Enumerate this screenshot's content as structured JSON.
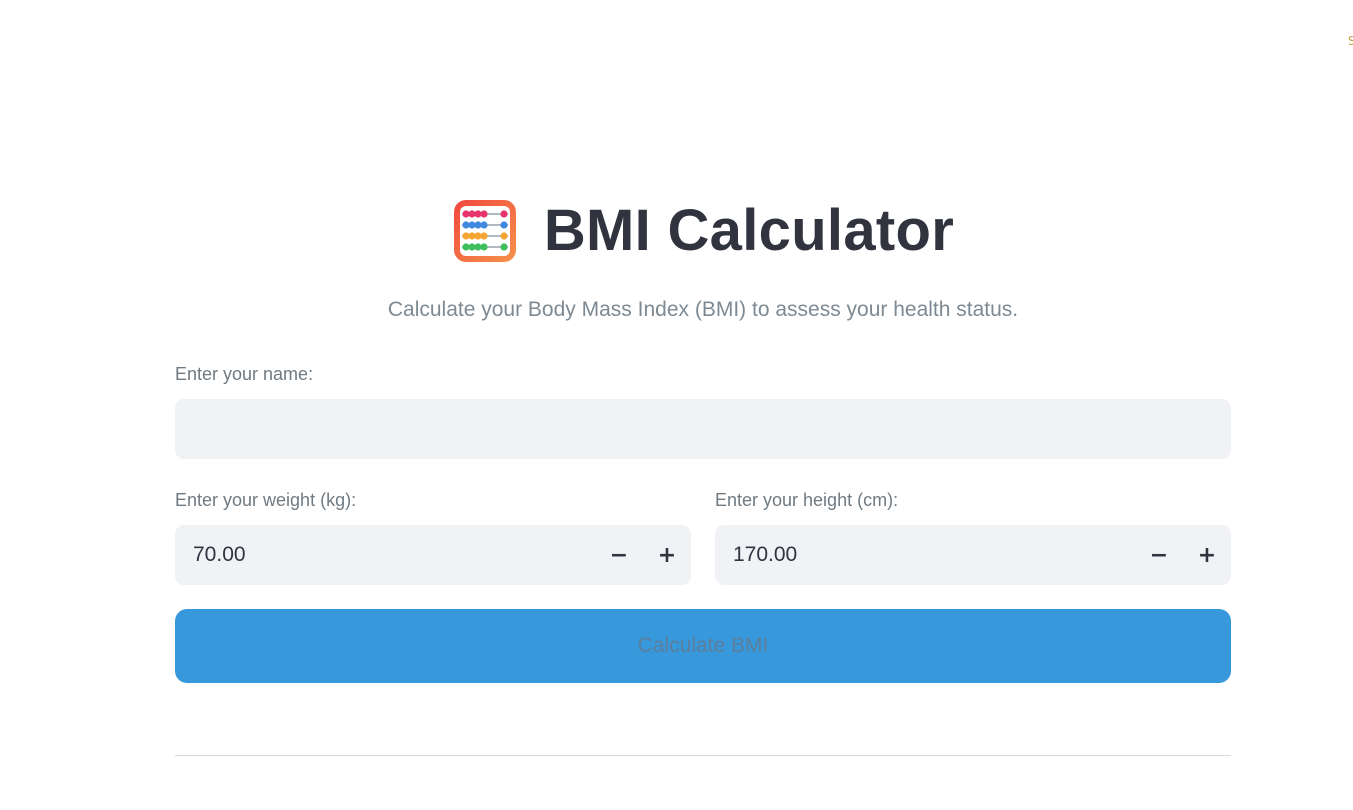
{
  "app": {
    "title": "BMI Calculator",
    "subtitle": "Calculate your Body Mass Index (BMI) to assess your health status.",
    "icon": "abacus-icon",
    "corner_status": "S"
  },
  "form": {
    "name": {
      "label": "Enter your name:",
      "value": ""
    },
    "weight": {
      "label": "Enter your weight (kg):",
      "value": "70.00",
      "decrement_label": "−",
      "increment_label": "+"
    },
    "height": {
      "label": "Enter your height (cm):",
      "value": "170.00",
      "decrement_label": "−",
      "increment_label": "+"
    },
    "submit_label": "Calculate BMI"
  },
  "colors": {
    "accent": "#3898dc",
    "input_bg": "#f0f2f6",
    "title": "#31333f",
    "muted": "#7d8a93"
  }
}
